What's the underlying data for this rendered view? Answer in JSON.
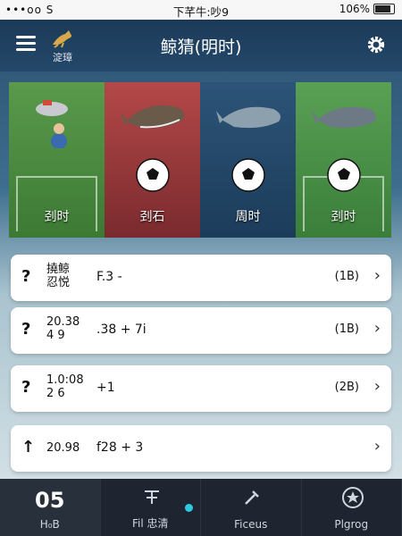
{
  "status_bar": {
    "left": "•••oo S",
    "carrier_time": "下芊牛:吵9",
    "battery": "106%"
  },
  "header": {
    "title": "鲸猜(明时)",
    "logo_caption": "淀璋"
  },
  "categories": [
    {
      "label": "刭时"
    },
    {
      "label": "刭石"
    },
    {
      "label": "周时"
    },
    {
      "label": "刭时"
    }
  ],
  "list": [
    {
      "icon": "?",
      "line1": "撓",
      "line2": "忍悦",
      "name": "鲸",
      "extra": "F.3 -",
      "count": "(1B)"
    },
    {
      "icon": "?",
      "line1": "20.38",
      "line2": "4 9",
      "extra": ".38 + 7i",
      "count": "(1B)"
    },
    {
      "icon": "?",
      "line1": "1.0:08",
      "line2": "2 6",
      "extra": "+1",
      "count": "(2B)"
    },
    {
      "icon": "↑",
      "line1": "20.98",
      "line2": "",
      "extra": "f28 + 3",
      "count": ""
    }
  ],
  "nav": [
    {
      "top": "05",
      "label": "H₀B"
    },
    {
      "label": "Fil 忠清"
    },
    {
      "label": "Fiᴄeus"
    },
    {
      "label": "Plgrog"
    }
  ],
  "colors": {
    "accent_dot": "#2ec8e0",
    "header_bg": "#1c3a58",
    "nav_bg": "#1e2530"
  }
}
